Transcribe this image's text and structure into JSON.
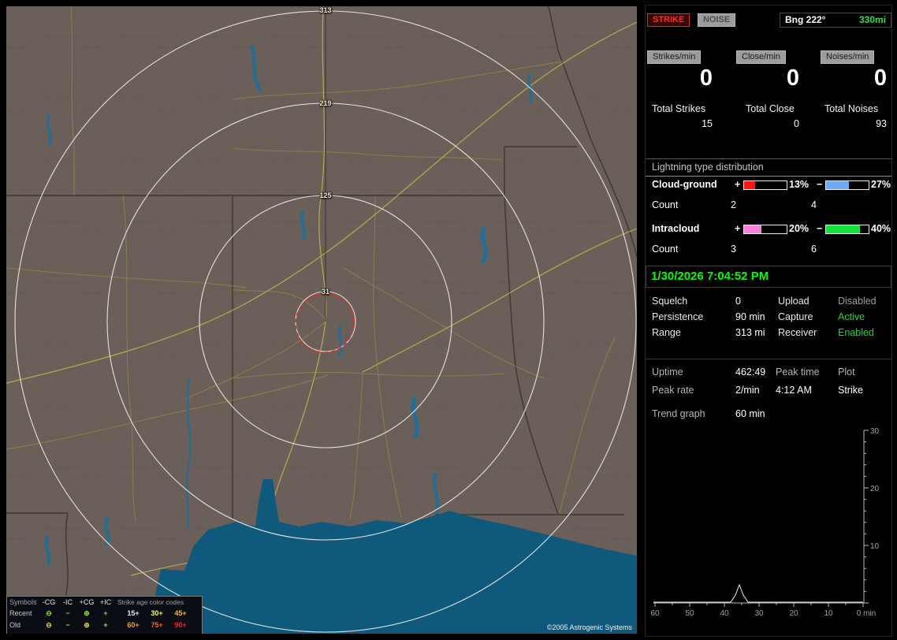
{
  "map": {
    "ring_labels": [
      "313",
      "219",
      "125",
      "31"
    ],
    "attribution": "©2005 Astrogenic Systems",
    "legend": {
      "symbols_title": "Symbols",
      "columns": [
        "-CG",
        "-IC",
        "+CG",
        "+IC"
      ],
      "age_title": "Strike age color codes",
      "recent": {
        "label": "Recent",
        "color": "#8fdc3c",
        "symbols": [
          "⊖",
          "−",
          "⊕",
          "+"
        ],
        "ages": [
          {
            "label": "15+",
            "color": "#dfe4ff"
          },
          {
            "label": "30+",
            "color": "#ffff3d"
          },
          {
            "label": "45+",
            "color": "#ffb51e"
          }
        ]
      },
      "old": {
        "label": "Old",
        "color": "#e2d23a",
        "symbols": [
          "⊖",
          "−",
          "⊕",
          "+"
        ],
        "ages": [
          {
            "label": "60+",
            "color": "#ff9c1e"
          },
          {
            "label": "75+",
            "color": "#ff5c1e"
          },
          {
            "label": "90+",
            "color": "#ff2020"
          }
        ]
      }
    }
  },
  "panel": {
    "strike_button": "STRIKE",
    "noise_button": "NOISE",
    "bearing": {
      "label": "Bng 222°",
      "range": "330mi",
      "range_color": "#2ee04e"
    },
    "rates": [
      {
        "label": "Strikes/min",
        "value": "0"
      },
      {
        "label": "Close/min",
        "value": "0"
      },
      {
        "label": "Noises/min",
        "value": "0"
      }
    ],
    "totals": [
      {
        "label": "Total Strikes",
        "value": "15"
      },
      {
        "label": "Total Close",
        "value": "0"
      },
      {
        "label": "Total Noises",
        "value": "93"
      }
    ],
    "distribution": {
      "title": "Lightning type distribution",
      "count_label": "Count",
      "rows": [
        {
          "label": "Cloud-ground",
          "plus": "+",
          "minus": "−",
          "pos_pct": "13%",
          "neg_pct": "27%",
          "pos_count": "2",
          "neg_count": "4",
          "pos_color": "#ff1212",
          "neg_color": "#6fa8f5",
          "pos_fill": "26%",
          "neg_fill": "54%"
        },
        {
          "label": "Intracloud",
          "plus": "+",
          "minus": "−",
          "pos_pct": "20%",
          "neg_pct": "40%",
          "pos_count": "3",
          "neg_count": "6",
          "pos_color": "#f781d8",
          "neg_color": "#17e23c",
          "pos_fill": "40%",
          "neg_fill": "80%"
        }
      ]
    },
    "datetime": "1/30/2026 7:04:52 PM",
    "settings": [
      {
        "l1": "Squelch",
        "v1": "0",
        "l2": "Upload",
        "v2": "Disabled",
        "v2_color": "#9e9e9e"
      },
      {
        "l1": "Persistence",
        "v1": "90 min",
        "l2": "Capture",
        "v2": "Active",
        "v2_color": "#1ed83a"
      },
      {
        "l1": "Range",
        "v1": "313 mi",
        "l2": "Receiver",
        "v2": "Enabled",
        "v2_color": "#1ed83a"
      }
    ],
    "stats": {
      "uptime_label": "Uptime",
      "uptime": "462:49",
      "peak_time_label": "Peak time",
      "plot_label": "Plot",
      "peak_rate_label": "Peak rate",
      "peak_rate": "2/min",
      "peak_time": "4:12 AM",
      "plot_value": "Strike"
    },
    "trend": {
      "label": "Trend graph",
      "window": "60 min",
      "y_ticks": [
        "30",
        "20",
        "10"
      ],
      "x_ticks": [
        "60",
        "50",
        "40",
        "30",
        "20",
        "10",
        "0 min"
      ]
    }
  }
}
